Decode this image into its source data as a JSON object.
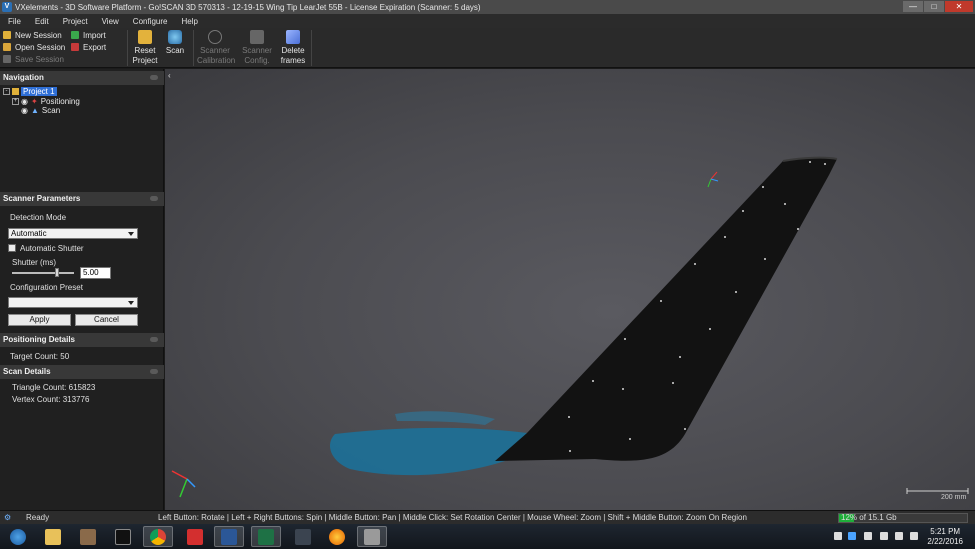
{
  "window": {
    "title": "VXelements - 3D Software Platform - Go!SCAN 3D 570313 - 12-19-15 Wing Tip LearJet 55B - License Expiration (Scanner: 5 days)",
    "controls": [
      "minimize",
      "maximize",
      "close"
    ]
  },
  "menu": [
    "File",
    "Edit",
    "Project",
    "View",
    "Configure",
    "Help"
  ],
  "toolbar": {
    "new_session": "New Session",
    "open_session": "Open Session",
    "save_session": "Save Session",
    "import": "Import",
    "export": "Export",
    "reset_project": [
      "Reset",
      "Project"
    ],
    "scan": "Scan",
    "scanner_calibration": [
      "Scanner",
      "Calibration"
    ],
    "scanner_config": [
      "Scanner",
      "Config."
    ],
    "delete_frames": [
      "Delete",
      "frames"
    ]
  },
  "navigation": {
    "header": "Navigation",
    "project": "Project 1",
    "positioning": "Positioning",
    "scan": "Scan"
  },
  "scanner_parameters": {
    "header": "Scanner Parameters",
    "detection_mode_label": "Detection Mode",
    "detection_mode_value": "Automatic",
    "automatic_shutter_label": "Automatic Shutter",
    "automatic_shutter_checked": false,
    "shutter_label": "Shutter (ms)",
    "shutter_value": "5.00",
    "configuration_preset_label": "Configuration Preset",
    "configuration_preset_value": "",
    "apply": "Apply",
    "cancel": "Cancel"
  },
  "positioning_details": {
    "header": "Positioning Details",
    "target_count": "Target Count: 50"
  },
  "scan_details": {
    "header": "Scan Details",
    "triangle_count": "Triangle Count: 615823",
    "vertex_count": "Vertex Count: 313776"
  },
  "viewport": {
    "scale_label": "200 mm"
  },
  "status": {
    "ready": "Ready",
    "hint": "Left Button: Rotate  |  Left + Right Buttons: Spin  |  Middle Button: Pan  |  Middle Click: Set Rotation Center  |  Mouse Wheel: Zoom  |  Shift + Middle Button: Zoom On Region",
    "memory_percent": "12%",
    "memory_fraction": 0.12,
    "memory_total": "of 15.1 Gb"
  },
  "taskbar": {
    "time": "5:21 PM",
    "date": "2/22/2016",
    "apps": [
      "start-orb",
      "file-explorer",
      "files",
      "terminal",
      "chrome",
      "acrobat",
      "word",
      "excel",
      "recycle",
      "firefox",
      "vxelements"
    ]
  },
  "colors": {
    "scan_surface": "#1f6f95",
    "selection": "#2f6fd6",
    "memory_fill": "#1fae3a"
  }
}
